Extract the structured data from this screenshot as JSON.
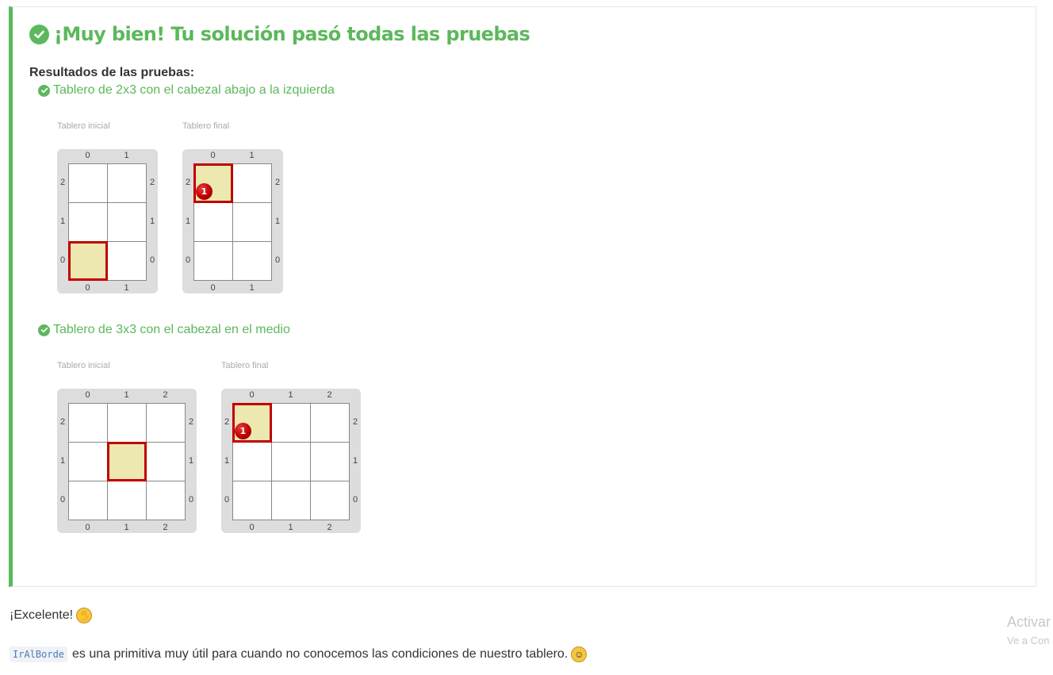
{
  "result": {
    "title": "¡Muy bien! Tu solución pasó todas las pruebas",
    "subtitle": "Resultados de las pruebas:",
    "accent_color": "#5cb85c",
    "status_icon": "check-circle-icon"
  },
  "tests": [
    {
      "title": "Tablero de 2x3 con el cabezal abajo a la izquierda",
      "initial_label": "Tablero inicial",
      "final_label": "Tablero final",
      "initial": {
        "cols": 2,
        "rows": 3,
        "head": [
          0,
          0
        ],
        "balls": []
      },
      "final": {
        "cols": 2,
        "rows": 3,
        "head": [
          0,
          2
        ],
        "balls": [
          {
            "x": 0,
            "y": 2,
            "count": "1"
          }
        ]
      }
    },
    {
      "title": "Tablero de 3x3 con el cabezal en el medio",
      "initial_label": "Tablero inicial",
      "final_label": "Tablero final",
      "initial": {
        "cols": 3,
        "rows": 3,
        "head": [
          1,
          1
        ],
        "balls": []
      },
      "final": {
        "cols": 3,
        "rows": 3,
        "head": [
          0,
          2
        ],
        "balls": [
          {
            "x": 0,
            "y": 2,
            "count": "1"
          }
        ]
      }
    }
  ],
  "messages": {
    "excelente": "¡Excelente!",
    "excelente_emoji": "clapping-hands-icon",
    "code": "IrAlBorde",
    "line2": "es una primitiva muy útil para cuando no conocemos las condiciones de nuestro tablero.",
    "line2_emoji": "smiling-face-icon"
  },
  "watermark": {
    "line1": "Activar",
    "line2": "Ve a Con"
  },
  "colors": {
    "head_fill": "#ece8b0",
    "head_border": "#c00000",
    "ball": "#c00000",
    "board_bg": "#dddddd"
  }
}
